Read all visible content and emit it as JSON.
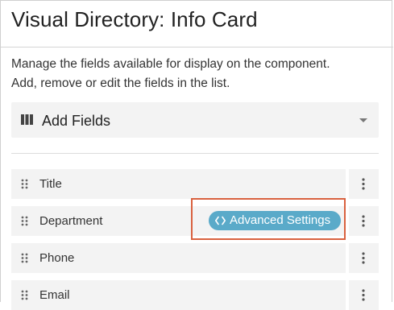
{
  "header": {
    "title": "Visual Directory: Info Card"
  },
  "description": {
    "line1": "Manage the fields available for display on the component.",
    "line2": "Add, remove or edit the fields in the list."
  },
  "add_fields": {
    "label": "Add Fields",
    "icon": "columns-icon"
  },
  "fields": [
    {
      "label": "Title"
    },
    {
      "label": "Department"
    },
    {
      "label": "Phone"
    },
    {
      "label": "Email"
    }
  ],
  "advanced_settings": {
    "label": "Advanced Settings",
    "icon": "code-icon"
  },
  "colors": {
    "pill": "#5aaac9",
    "highlight": "#d9613f",
    "row_bg": "#f3f3f3"
  }
}
